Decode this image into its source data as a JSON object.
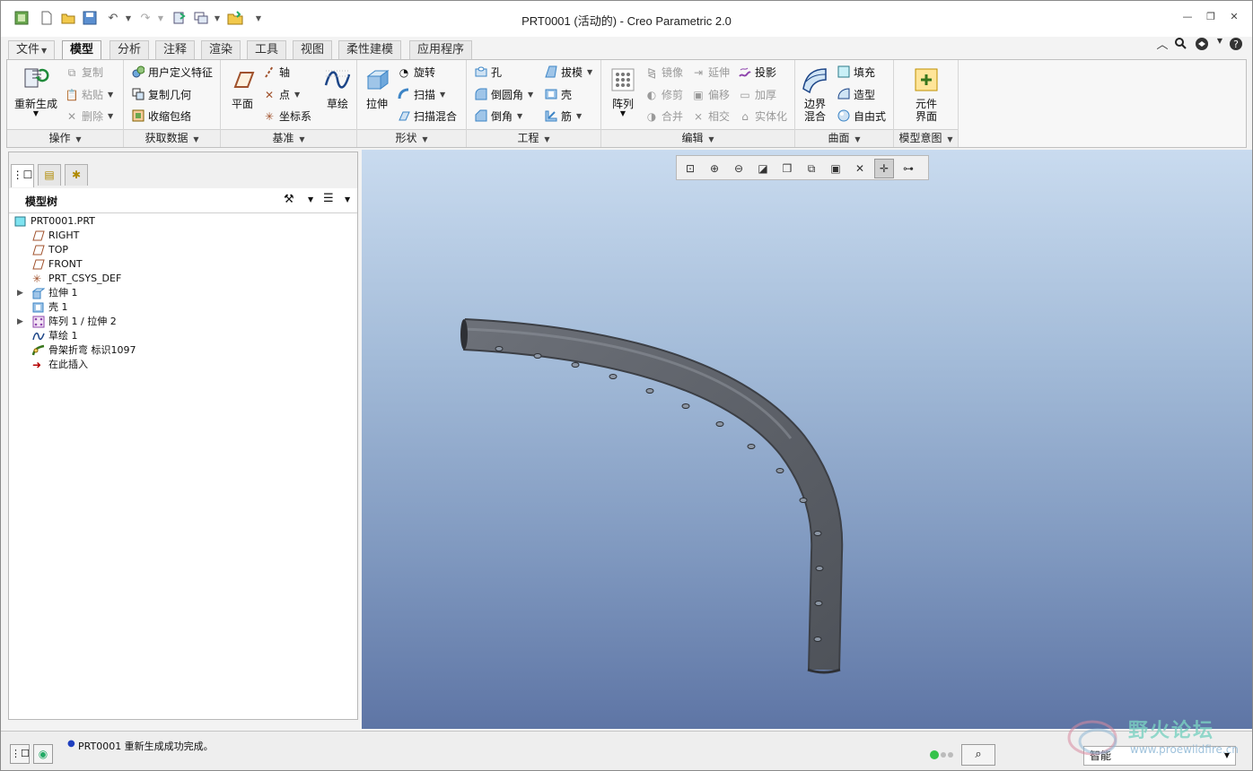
{
  "window": {
    "title": "PRT0001 (活动的) - Creo Parametric 2.0"
  },
  "tabs": [
    "文件",
    "模型",
    "分析",
    "注释",
    "渲染",
    "工具",
    "视图",
    "柔性建模",
    "应用程序"
  ],
  "ribbon": {
    "operations": {
      "footer": "操作",
      "regenerate": "重新生成",
      "copy": "复制",
      "paste": "粘贴",
      "delete": "删除"
    },
    "get_data": {
      "footer": "获取数据",
      "udf": "用户定义特征",
      "copy_geom": "复制几何",
      "shrinkwrap": "收缩包络"
    },
    "datum": {
      "footer": "基准",
      "plane": "平面",
      "axis": "轴",
      "point": "点",
      "csys": "坐标系",
      "sketch": "草绘"
    },
    "shapes": {
      "footer": "形状",
      "extrude": "拉伸",
      "revolve": "旋转",
      "sweep": "扫描",
      "swept_blend": "扫描混合"
    },
    "engineering": {
      "footer": "工程",
      "hole": "孔",
      "round": "倒圆角",
      "chamfer": "倒角",
      "draft": "拔模",
      "shell": "壳",
      "rib": "筋"
    },
    "editing": {
      "footer": "编辑",
      "pattern": "阵列",
      "mirror": "镜像",
      "trim": "修剪",
      "merge": "合并",
      "extend": "延伸",
      "offset": "偏移",
      "intersect": "相交",
      "project": "投影",
      "thicken": "加厚",
      "solidify": "实体化"
    },
    "surfaces": {
      "footer": "曲面",
      "boundary_line1": "边界",
      "boundary_line2": "混合",
      "fill": "填充",
      "style": "造型",
      "freestyle": "自由式"
    },
    "model_intent": {
      "footer": "模型意图",
      "component_line1": "元件",
      "component_line2": "界面"
    }
  },
  "model_tree": {
    "title": "模型树",
    "items": [
      {
        "label": "PRT0001.PRT"
      },
      {
        "label": "RIGHT"
      },
      {
        "label": "TOP"
      },
      {
        "label": "FRONT"
      },
      {
        "label": "PRT_CSYS_DEF"
      },
      {
        "label": "拉伸 1"
      },
      {
        "label": "壳 1"
      },
      {
        "label": "阵列 1 / 拉伸 2"
      },
      {
        "label": "草绘 1"
      },
      {
        "label": "骨架折弯 标识1097"
      },
      {
        "label": "在此插入"
      }
    ]
  },
  "status": {
    "message": "PRT0001 重新生成成功完成。",
    "filter_value": "智能"
  },
  "watermark": {
    "name": "野火论坛",
    "url": "www.proewildfire.cn"
  },
  "colors": {
    "viewport_top": "#c9dbef",
    "viewport_bottom": "#5e75a5",
    "part": "#5d6168"
  }
}
